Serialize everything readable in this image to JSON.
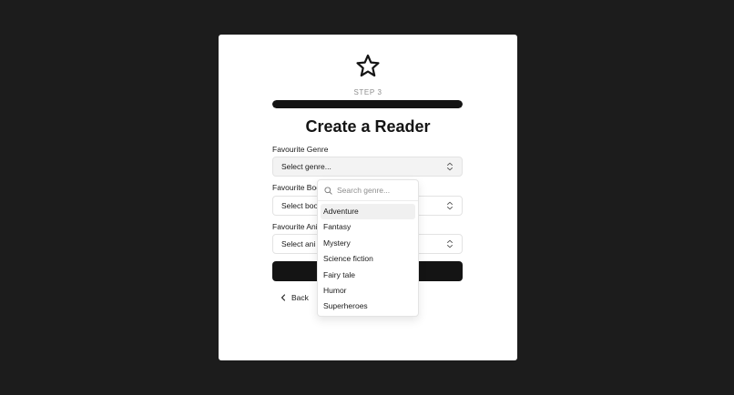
{
  "onboarding": {
    "step_label": "STEP 3",
    "progress": 1.0,
    "title": "Create a Reader"
  },
  "form": {
    "genre": {
      "label": "Favourite Genre",
      "value": "Select genre..."
    },
    "book": {
      "label": "Favourite Boo",
      "value": "Select boo"
    },
    "animal": {
      "label": "Favourite Ani",
      "value": "Select ani"
    },
    "submit_label": "",
    "back_label": "Back"
  },
  "dropdown": {
    "search_placeholder": "Search genre...",
    "items": [
      "Adventure",
      "Fantasy",
      "Mystery",
      "Science fiction",
      "Fairy tale",
      "Humor",
      "Superheroes"
    ],
    "highlighted_index": 0
  },
  "icons": {
    "logo": "star-icon",
    "select": "chevron-up-down-icon",
    "back": "chevron-left-icon",
    "search": "search-icon"
  },
  "colors": {
    "background": "#1c1c1c",
    "card": "#ffffff",
    "primary": "#141414",
    "muted_text": "#8e8e8e"
  }
}
